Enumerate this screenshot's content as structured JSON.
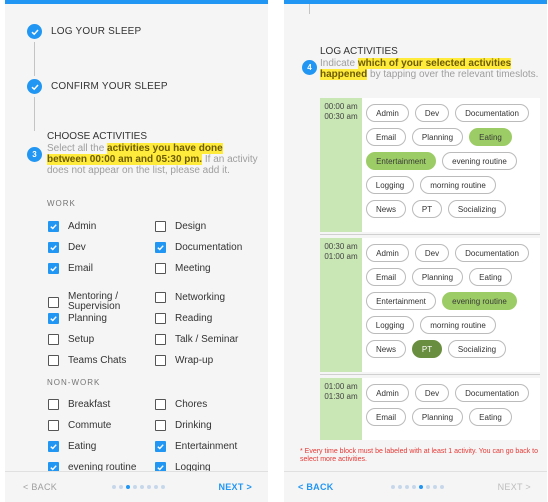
{
  "left": {
    "steps": [
      {
        "title": "LOG YOUR SLEEP"
      },
      {
        "title": "CONFIRM YOUR SLEEP"
      }
    ],
    "choose": {
      "number": "3",
      "title": "CHOOSE ACTIVITIES",
      "instr_pre": "Select all the ",
      "instr_hl": "activities you have done between 00:00 am and 05:30 pm.",
      "instr_post": " If an activity does not appear on the list, please add it."
    },
    "work_label": "WORK",
    "nonwork_label": "NON-WORK",
    "work_items": [
      {
        "label": "Admin",
        "checked": true
      },
      {
        "label": "Design",
        "checked": false
      },
      {
        "label": "Dev",
        "checked": true
      },
      {
        "label": "Documentation",
        "checked": true
      },
      {
        "label": "Email",
        "checked": true
      },
      {
        "label": "Meeting",
        "checked": false
      },
      {
        "label": "Mentoring / Supervision",
        "checked": false
      },
      {
        "label": "Networking",
        "checked": false
      },
      {
        "label": "Planning",
        "checked": true
      },
      {
        "label": "Reading",
        "checked": false
      },
      {
        "label": "Setup",
        "checked": false
      },
      {
        "label": "Talk / Seminar",
        "checked": false
      },
      {
        "label": "Teams Chats",
        "checked": false
      },
      {
        "label": "Wrap-up",
        "checked": false
      }
    ],
    "nonwork_items": [
      {
        "label": "Breakfast",
        "checked": false
      },
      {
        "label": "Chores",
        "checked": false
      },
      {
        "label": "Commute",
        "checked": false
      },
      {
        "label": "Drinking",
        "checked": false
      },
      {
        "label": "Eating",
        "checked": true
      },
      {
        "label": "Entertainment",
        "checked": true
      },
      {
        "label": "evening routine",
        "checked": true
      },
      {
        "label": "Logging",
        "checked": true
      }
    ],
    "nav": {
      "back": "< BACK",
      "next": "NEXT >",
      "dots_total": 8,
      "dots_active": 2
    }
  },
  "right": {
    "log": {
      "number": "4",
      "title": "LOG ACTIVITIES",
      "instr_pre": "Indicate ",
      "instr_hl": "which of your selected activities happened",
      "instr_post": " by tapping over the relevant timeslots."
    },
    "slots": [
      {
        "start": "00:00 am",
        "end": "00:30 am",
        "chips": [
          {
            "label": "Admin",
            "state": "off"
          },
          {
            "label": "Dev",
            "state": "off"
          },
          {
            "label": "Documentation",
            "state": "off"
          },
          {
            "label": "Email",
            "state": "off"
          },
          {
            "label": "Planning",
            "state": "off"
          },
          {
            "label": "Eating",
            "state": "green"
          },
          {
            "label": "Entertainment",
            "state": "green"
          },
          {
            "label": "evening routine",
            "state": "off"
          },
          {
            "label": "Logging",
            "state": "off"
          },
          {
            "label": "morning routine",
            "state": "off"
          },
          {
            "label": "News",
            "state": "off"
          },
          {
            "label": "PT",
            "state": "off"
          },
          {
            "label": "Socializing",
            "state": "off"
          }
        ]
      },
      {
        "start": "00:30 am",
        "end": "01:00 am",
        "chips": [
          {
            "label": "Admin",
            "state": "off"
          },
          {
            "label": "Dev",
            "state": "off"
          },
          {
            "label": "Documentation",
            "state": "off"
          },
          {
            "label": "Email",
            "state": "off"
          },
          {
            "label": "Planning",
            "state": "off"
          },
          {
            "label": "Eating",
            "state": "off"
          },
          {
            "label": "Entertainment",
            "state": "off"
          },
          {
            "label": "evening routine",
            "state": "green"
          },
          {
            "label": "Logging",
            "state": "off"
          },
          {
            "label": "morning routine",
            "state": "off"
          },
          {
            "label": "News",
            "state": "off"
          },
          {
            "label": "PT",
            "state": "dark"
          },
          {
            "label": "Socializing",
            "state": "off"
          }
        ]
      },
      {
        "start": "01:00 am",
        "end": "01:30 am",
        "chips": [
          {
            "label": "Admin",
            "state": "off"
          },
          {
            "label": "Dev",
            "state": "off"
          },
          {
            "label": "Documentation",
            "state": "off"
          },
          {
            "label": "Email",
            "state": "off"
          },
          {
            "label": "Planning",
            "state": "off"
          },
          {
            "label": "Eating",
            "state": "off"
          }
        ]
      }
    ],
    "footnote": "* Every time block must be labeled with at least 1 activity. You can go back to select more activities.",
    "nav": {
      "back": "< BACK",
      "next": "NEXT >",
      "dots_total": 8,
      "dots_active": 4
    }
  },
  "colors": {
    "accent": "#2196f3",
    "highlight": "#ffeb3b",
    "selected_green": "#9ccc65",
    "selected_dark": "#6a8e3f",
    "slot_green": "#c9e6b5",
    "error": "#e53935"
  }
}
